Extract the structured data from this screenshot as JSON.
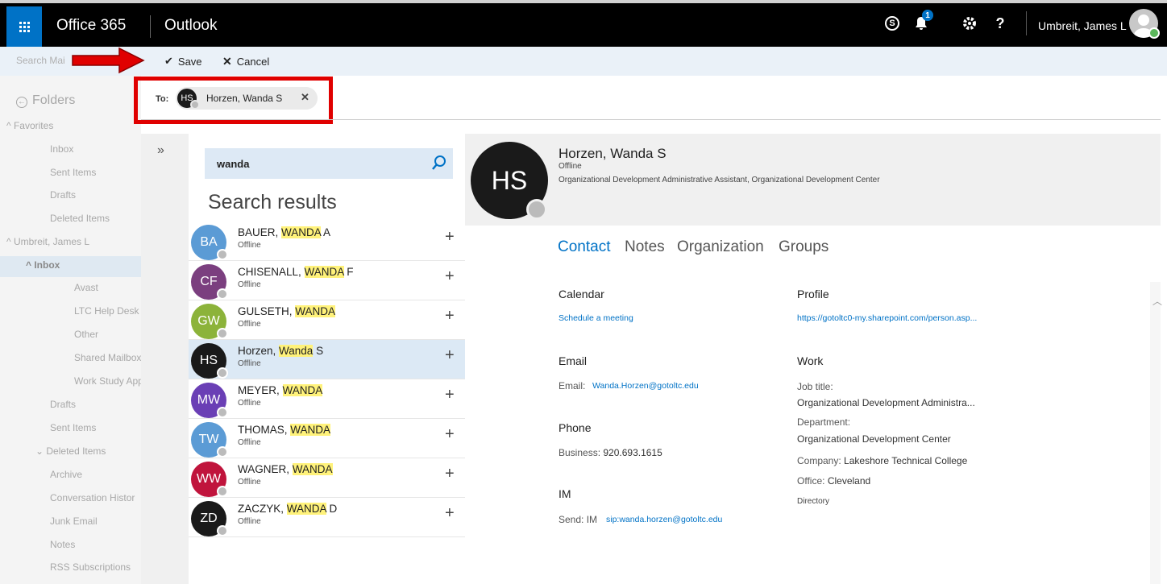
{
  "topbar": {
    "brand": "Office 365",
    "app": "Outlook",
    "skype_glyph": "S",
    "notification_count": "1",
    "help_glyph": "?",
    "user_name": "Umbreit, James L"
  },
  "command_bar": {
    "search_placeholder": "Search Mai",
    "save_label": "Save",
    "cancel_label": "Cancel"
  },
  "folders": {
    "header": "Folders",
    "favorites": "Favorites",
    "fav_items": [
      "Inbox",
      "Sent Items",
      "Drafts",
      "Deleted Items"
    ],
    "account": "Umbreit, James L",
    "inbox": "Inbox",
    "inbox_sub": [
      "Avast",
      "LTC Help Desk",
      "Other",
      "Shared Mailbox",
      "Work Study App"
    ],
    "items": [
      "Drafts",
      "Sent Items",
      "Deleted Items",
      "Archive",
      "Conversation Histor",
      "Junk Email",
      "Notes",
      "RSS Subscriptions"
    ]
  },
  "to_field": {
    "label": "To:",
    "recipient_initials": "HS",
    "recipient_name": "Horzen, Wanda S",
    "remove_glyph": "✕"
  },
  "search": {
    "expand_glyph": "»",
    "query": "wanda",
    "results_title": "Search results",
    "results": [
      {
        "initials": "BA",
        "pre": "BAUER, ",
        "match": "WANDA",
        "post": " A",
        "status": "Offline",
        "color": "#5b9bd5"
      },
      {
        "initials": "CF",
        "pre": "CHISENALL, ",
        "match": "WANDA",
        "post": " F",
        "status": "Offline",
        "color": "#7b3f7f"
      },
      {
        "initials": "GW",
        "pre": "GULSETH, ",
        "match": "WANDA",
        "post": "",
        "status": "Offline",
        "color": "#8cb33a"
      },
      {
        "initials": "HS",
        "pre": "Horzen, ",
        "match": "Wanda",
        "post": " S",
        "status": "Offline",
        "color": "#1a1a1a"
      },
      {
        "initials": "MW",
        "pre": "MEYER, ",
        "match": "WANDA",
        "post": "",
        "status": "Offline",
        "color": "#6a3fb5"
      },
      {
        "initials": "TW",
        "pre": "THOMAS, ",
        "match": "WANDA",
        "post": "",
        "status": "Offline",
        "color": "#5b9bd5"
      },
      {
        "initials": "WW",
        "pre": "WAGNER, ",
        "match": "WANDA",
        "post": "",
        "status": "Offline",
        "color": "#c0143c"
      },
      {
        "initials": "ZD",
        "pre": "ZACZYK, ",
        "match": "WANDA",
        "post": " D",
        "status": "Offline",
        "color": "#1a1a1a"
      }
    ],
    "add_glyph": "+"
  },
  "contact": {
    "initials": "HS",
    "name": "Horzen, Wanda S",
    "status": "Offline",
    "title": "Organizational Development Administrative Assistant, Organizational Development Center",
    "tabs": [
      "Contact",
      "Notes",
      "Organization",
      "Groups"
    ],
    "calendar_heading": "Calendar",
    "schedule_link": "Schedule a meeting",
    "email_heading": "Email",
    "email_label": "Email:",
    "email_value": "Wanda.Horzen@gotoltc.edu",
    "phone_heading": "Phone",
    "phone_label": "Business:",
    "phone_value": "920.693.1615",
    "im_heading": "IM",
    "im_label": "Send: IM",
    "im_value": "sip:wanda.horzen@gotoltc.edu",
    "profile_heading": "Profile",
    "profile_link": "https://gotoltc0-my.sharepoint.com/person.asp...",
    "work_heading": "Work",
    "job_title_label": "Job title:",
    "job_title_value": "Organizational Development Administra...",
    "department_label": "Department:",
    "department_value": "Organizational Development Center",
    "company_label": "Company:",
    "company_value": "Lakeshore Technical College",
    "office_label": "Office:",
    "office_value": "Cleveland",
    "directory": "Directory"
  },
  "colors": {
    "accent": "#0072c6",
    "highlight": "#fff27a",
    "annotation": "#e00000"
  }
}
